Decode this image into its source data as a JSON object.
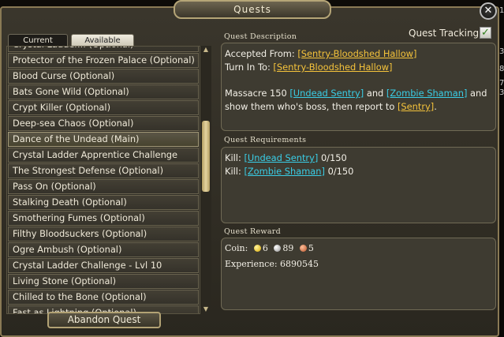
{
  "window": {
    "title": "Quests"
  },
  "tabs": [
    {
      "label": "Current"
    },
    {
      "label": "Available"
    }
  ],
  "quest_tracking": {
    "label": "Quest Tracking",
    "checked": true
  },
  "quest_list": {
    "partial_top": "Crystal Ladder... (Optional)",
    "items": [
      "Protector of the Frozen Palace (Optional)",
      "Blood Curse (Optional)",
      "Bats Gone Wild (Optional)",
      "Crypt Killer (Optional)",
      "Deep-sea Chaos (Optional)",
      "Dance of the Undead (Main)",
      "Crystal Ladder Apprentice Challenge",
      "The Strongest Defense (Optional)",
      "Pass On (Optional)",
      "Stalking Death (Optional)",
      "Smothering Fumes (Optional)",
      "Filthy Bloodsuckers (Optional)",
      "Ogre Ambush (Optional)",
      "Crystal Ladder Challenge - Lvl 10",
      "Living Stone (Optional)",
      "Chilled to the Bone (Optional)"
    ],
    "partial_bottom": "Fast as Lightning (Optional)",
    "selected": "Dance of the Undead (Main)"
  },
  "abandon_button": "Abandon Quest",
  "description": {
    "title": "Quest Description",
    "accepted_label": "Accepted From: ",
    "accepted_npc": "[Sentry-Bloodshed Hallow]",
    "turnin_label": "Turn In To: ",
    "turnin_npc": "[Sentry-Bloodshed Hallow]",
    "body_1": "Massacre 150 ",
    "target_1": "[Undead Sentry]",
    "body_2": " and ",
    "target_2": "[Zombie Shaman]",
    "body_3": " and",
    "body_4": "show them who's boss, then report to ",
    "report_to": "[Sentry]",
    "body_5": "."
  },
  "requirements": {
    "title": "Quest Requirements",
    "rows": [
      {
        "prefix": "Kill: ",
        "target": "[Undead Sentry]",
        "progress": "0/150"
      },
      {
        "prefix": "Kill: ",
        "target": "[Zombie Shaman]",
        "progress": "0/150"
      }
    ]
  },
  "reward": {
    "title": "Quest Reward",
    "coin_label": "Coin:",
    "gold": "6",
    "silver": "89",
    "copper": "5",
    "experience_label": "Experience: ",
    "experience_value": "6890545"
  },
  "edge_numbers": [
    "1",
    "3",
    "8",
    "7",
    "3"
  ]
}
